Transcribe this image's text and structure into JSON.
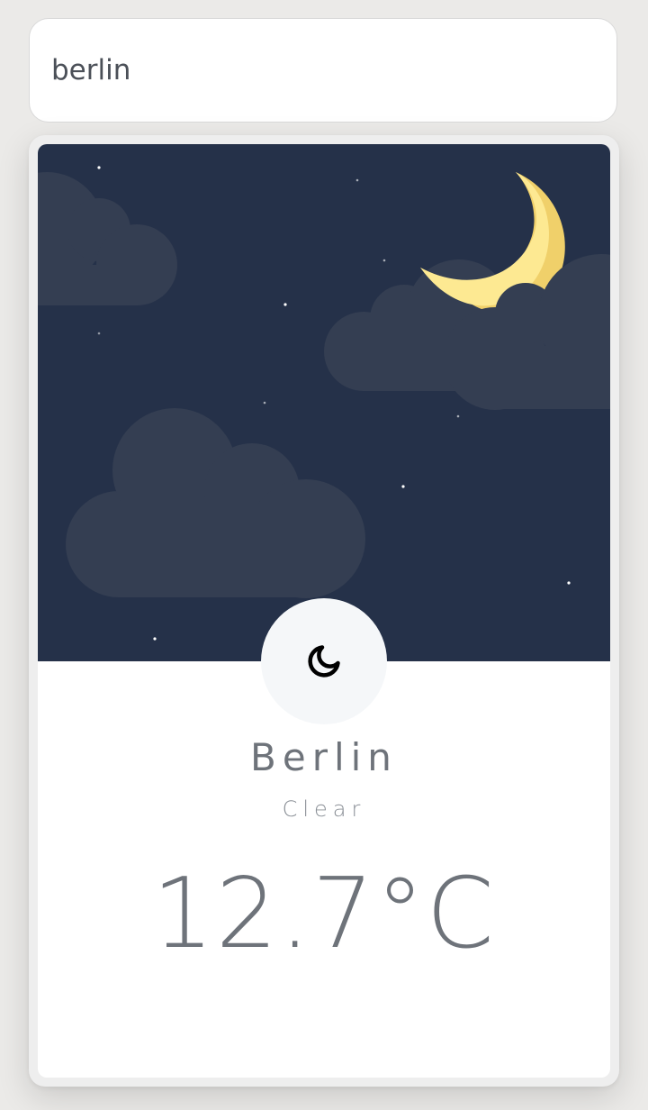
{
  "search": {
    "value": "berlin",
    "placeholder": ""
  },
  "weather": {
    "city": "Berlin",
    "condition": "Clear",
    "temperature": "12.7°C",
    "icon": "moon-icon"
  },
  "colors": {
    "sky": "#253149",
    "cloud": "#343e52",
    "moon_light": "#fde992",
    "moon_shadow": "#f0d06a",
    "text": "#6e737a"
  }
}
